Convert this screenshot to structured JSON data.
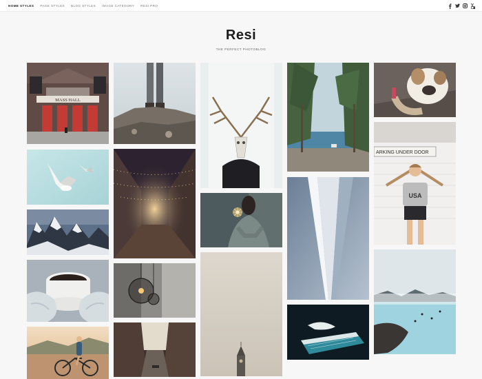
{
  "nav": {
    "items": [
      {
        "label": "HOME STYLES",
        "active": true
      },
      {
        "label": "PAGE STYLES",
        "active": false
      },
      {
        "label": "BLOG STYLES",
        "active": false
      },
      {
        "label": "IMAGE CATEGORY",
        "active": false
      },
      {
        "label": "RESI PRO",
        "active": false
      }
    ]
  },
  "social": [
    "facebook-icon",
    "twitter-icon",
    "instagram-icon",
    "youtube-icon"
  ],
  "brand": {
    "title": "Resi",
    "tagline": "THE PERFECT PHOTOBLOG"
  },
  "gallery": {
    "masshall_sign": "MASS   HALL",
    "parking_sign": "ARKING UNDER DOOR",
    "shirt_text": "USA"
  },
  "colors": {
    "background": "#f7f7f7",
    "title": "#1c1c1c",
    "nav_active": "#222222",
    "nav_inactive": "#777777"
  }
}
